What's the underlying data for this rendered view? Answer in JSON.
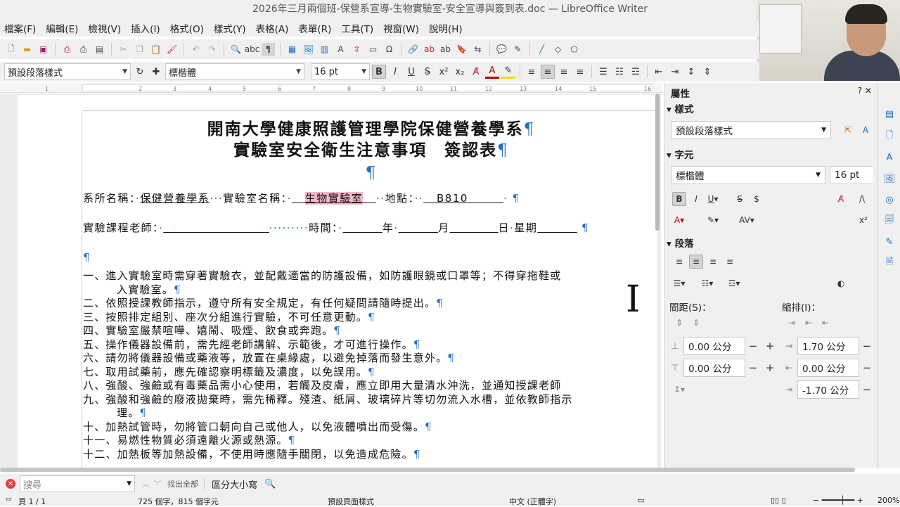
{
  "window": {
    "title": "2026年三月兩個班-保營系宣導-生物實驗室-安全宣導與簽到表.doc — LibreOffice Writer"
  },
  "menu": [
    "檔案(F)",
    "編輯(E)",
    "檢視(V)",
    "插入(I)",
    "格式(O)",
    "樣式(Y)",
    "表格(A)",
    "表單(R)",
    "工具(T)",
    "視窗(W)",
    "說明(H)"
  ],
  "formatting": {
    "paragraph_style": "預設段落樣式",
    "font_name": "標楷體",
    "font_size": "16 pt"
  },
  "ruler": {
    "ticks": [
      "1",
      "2",
      "3",
      "4",
      "5",
      "6",
      "7",
      "8",
      "9",
      "10",
      "11",
      "12",
      "13",
      "14",
      "15",
      "16"
    ]
  },
  "document": {
    "heading1": "開南大學健康照護管理學院保健營養學系",
    "heading2": "實驗室安全衛生注意事項　簽認表",
    "pilcrow": "¶",
    "line1": {
      "dept_label": "系所名稱：",
      "dept_value": "保健營養學系",
      "lab_label": "實驗室名稱：",
      "lab_value": "生物實驗室",
      "loc_label": "地點：",
      "loc_value": "B810"
    },
    "line2": {
      "teacher_label": "實驗課程老師：",
      "time_label": "時間：",
      "year": "年",
      "month": "月",
      "day": "日",
      "weekday": "星期"
    },
    "items": [
      {
        "num": "一、",
        "text": "進入實驗室時需穿著實驗衣，並配戴適當的防護設備，如防護眼鏡或口罩等；不得穿拖鞋或",
        "cont": "入實驗室。"
      },
      {
        "num": "二、",
        "text": "依照授課教師指示，遵守所有安全規定，有任何疑問請隨時提出。"
      },
      {
        "num": "三、",
        "text": "按照排定組別、座次分組進行實驗，不可任意更動。"
      },
      {
        "num": "四、",
        "text": "實驗室嚴禁喧嘩、嬉鬧、吸煙、飲食或奔跑。"
      },
      {
        "num": "五、",
        "text": "操作儀器設備前，需先經老師講解、示範後，才可進行操作。"
      },
      {
        "num": "六、",
        "text": "請勿將儀器設備或藥液等，放置在桌緣處，以避免掉落而發生意外。"
      },
      {
        "num": "七、",
        "text": "取用試藥前，應先確認察明標籤及濃度，以免誤用。"
      },
      {
        "num": "八、",
        "text": "強酸、強鹼或有毒藥品需小心使用，若觸及皮膚，應立即用大量清水沖洗，並通知授課老師"
      },
      {
        "num": "九、",
        "text": "強酸和強鹼的廢液拋棄時，需先稀釋。殘渣、紙屑、玻璃碎片等切勿流入水槽，並依教師指示",
        "cont": "理。"
      },
      {
        "num": "十、",
        "text": "加熱試管時，勿將管口朝向自己或他人，以免液體噴出而受傷。"
      },
      {
        "num": "十一、",
        "text": "易燃性物質必須遠離火源或熱源。"
      },
      {
        "num": "十二、",
        "text": "加熱板等加熱設備，不使用時應隨手關閉，以免造成危險。"
      }
    ]
  },
  "sidebar": {
    "title": "屬性",
    "styles_section": "樣式",
    "style_value": "預設段落樣式",
    "char_section": "字元",
    "font_value": "標楷體",
    "size_value": "16 pt",
    "para_section": "段落",
    "spacing_label": "間距(S)：",
    "indent_label": "縮排(I)：",
    "above": "0.00 公分",
    "below": "0.00 公分",
    "before_indent": "1.70 公分",
    "after_indent": "0.00 公分",
    "first_line": "-1.70 公分"
  },
  "findbar": {
    "placeholder": "搜尋",
    "find_all": "找出全部",
    "match_case": "區分大小寫"
  },
  "status": {
    "page": "頁 1 / 1",
    "words": "725 個字，815 個字元",
    "page_style": "預設頁面樣式",
    "language": "中文 (正體字)",
    "zoom": "200%"
  }
}
